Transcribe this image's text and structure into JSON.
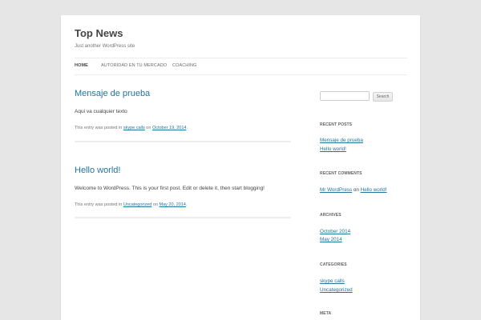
{
  "site": {
    "title": "Top News",
    "description": "Just another WordPress site"
  },
  "nav": {
    "items": [
      "HOME",
      "AUTORIDAD EN TU MERCADO",
      "COACHING"
    ],
    "active": "HOME"
  },
  "posts": [
    {
      "title": "Mensaje de prueba",
      "body": "Aqui va cualquier texto",
      "meta_prefix": "This entry was posted in",
      "category": "skype calls",
      "meta_on": "on",
      "date": "October 19, 2014",
      "meta_end": "."
    },
    {
      "title": "Hello world!",
      "body": "Welcome to WordPress. This is your first post. Edit or delete it, then start blogging!",
      "meta_prefix": "This entry was posted in",
      "category": "Uncategorized",
      "meta_on": "on",
      "date": "May 20, 2014",
      "meta_end": "."
    }
  ],
  "sidebar": {
    "search": {
      "value": "",
      "placeholder": "",
      "button_label": "Search"
    },
    "recent_posts": {
      "title": "RECENT POSTS",
      "items": [
        "Mensaje de prueba",
        "Hello world!"
      ]
    },
    "recent_comments": {
      "title": "RECENT COMMENTS",
      "author": "Mr WordPress",
      "on": "on",
      "post": "Hello world!"
    },
    "archives": {
      "title": "ARCHIVES",
      "items": [
        "October 2014",
        "May 2014"
      ]
    },
    "categories": {
      "title": "CATEGORIES",
      "items": [
        "skype calls",
        "Uncategorized"
      ]
    },
    "meta": {
      "title": "META"
    }
  },
  "colors": {
    "link": "#21759b",
    "background": "#e6e6e6",
    "page": "#ffffff",
    "text": "#444444"
  }
}
